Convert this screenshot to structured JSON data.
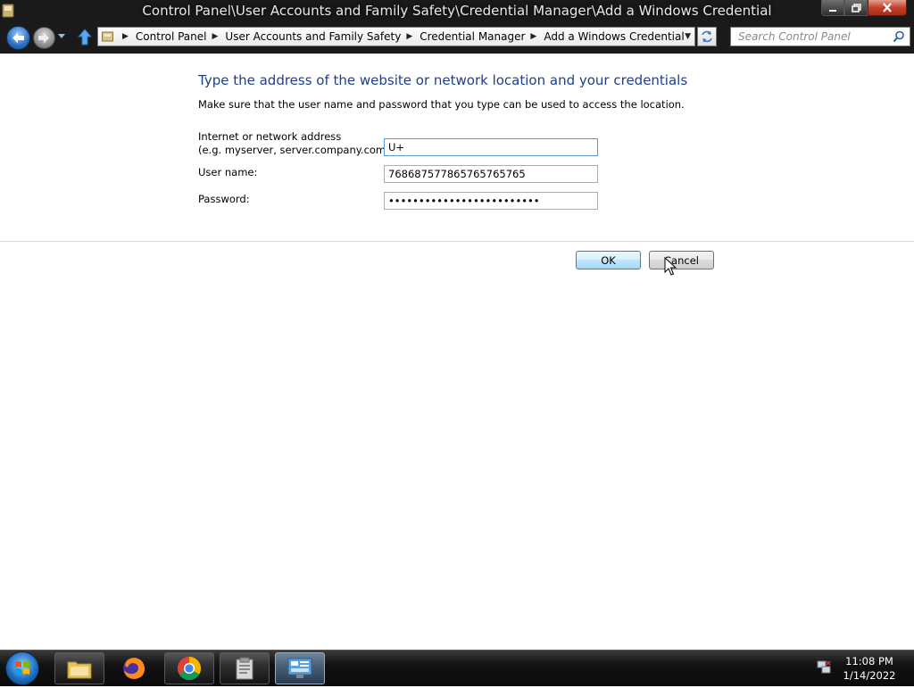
{
  "window": {
    "title": "Control Panel\\User Accounts and Family Safety\\Credential Manager\\Add a Windows Credential"
  },
  "address_bar": {
    "crumbs": [
      {
        "label": "Control Panel"
      },
      {
        "label": "User Accounts and Family Safety"
      },
      {
        "label": "Credential Manager"
      },
      {
        "label": "Add a Windows Credential"
      }
    ]
  },
  "search": {
    "placeholder": "Search Control Panel"
  },
  "form": {
    "heading": "Type the address of the website or network location and your credentials",
    "instructions": "Make sure that the user name and password that you type can be used to access the location.",
    "address_label_line1": "Internet or network address",
    "address_label_line2": "(e.g. myserver, server.company.com):",
    "address_value": "U+",
    "username_label": "User name:",
    "username_value": "768687577865765765765",
    "password_label": "Password:",
    "password_value": "•••••••••••••••••••••••••"
  },
  "buttons": {
    "ok": "OK",
    "cancel": "Cancel"
  },
  "taskbar": {
    "items": [
      "windows-explorer",
      "firefox",
      "chrome",
      "control-panel-app",
      "credential-manager"
    ],
    "time": "11:08 PM",
    "date": "1/14/2022"
  },
  "colors": {
    "heading": "#1e3f8a",
    "titlebar_bg": "#1a1a1a",
    "ok_border": "#3c7fb1"
  }
}
